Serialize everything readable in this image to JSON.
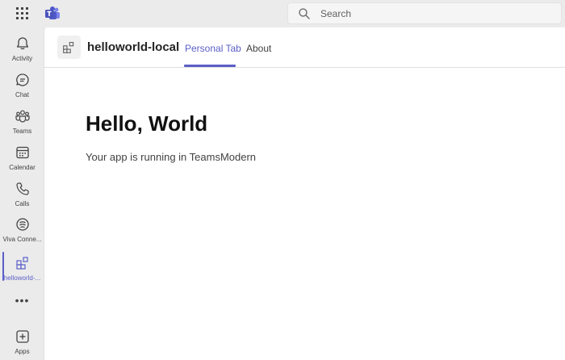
{
  "search": {
    "placeholder": "Search"
  },
  "rail": {
    "items": [
      {
        "label": "Activity",
        "icon": "bell-icon"
      },
      {
        "label": "Chat",
        "icon": "chat-icon"
      },
      {
        "label": "Teams",
        "icon": "teams-icon"
      },
      {
        "label": "Calendar",
        "icon": "calendar-icon"
      },
      {
        "label": "Calls",
        "icon": "phone-icon"
      },
      {
        "label": "Viva Conne...",
        "icon": "viva-connections-icon"
      },
      {
        "label": "helloworld-...",
        "icon": "app-grid-icon"
      },
      {
        "label": "Apps",
        "icon": "add-apps-icon"
      }
    ],
    "more_label": "•••"
  },
  "app": {
    "title": "helloworld-local",
    "tabs": [
      {
        "label": "Personal Tab"
      },
      {
        "label": "About"
      }
    ]
  },
  "content": {
    "heading": "Hello, World",
    "text": "Your app is running in TeamsModern"
  },
  "colors": {
    "accent": "#5b5fc7",
    "background": "#f0f0f0",
    "surface": "#ffffff"
  }
}
